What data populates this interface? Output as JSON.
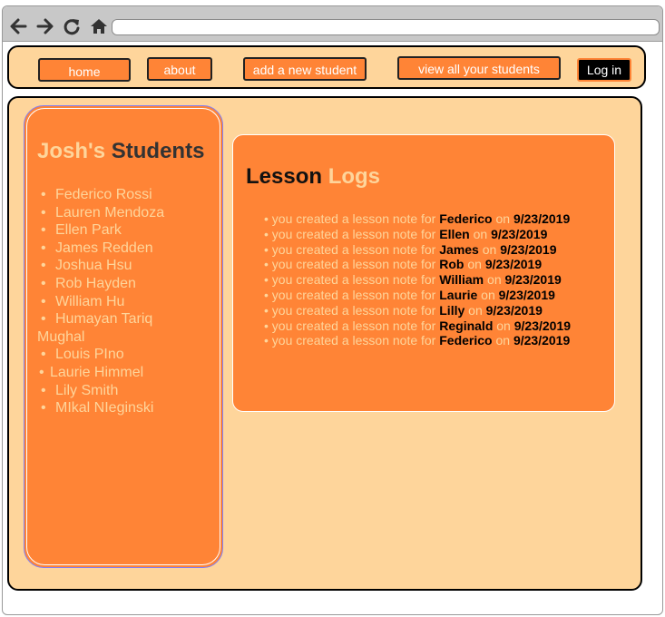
{
  "nav": {
    "home": "home",
    "about": "about",
    "add_student": "add a new student",
    "view_students": "view all your students",
    "login": "Log in"
  },
  "sidebar": {
    "title_owner": "Josh's",
    "title_word": "Students",
    "students": [
      {
        "bullet": "•",
        "name": "Federico Rossi"
      },
      {
        "bullet": "•",
        "name": "Lauren Mendoza"
      },
      {
        "bullet": "•",
        "name": "Ellen Park"
      },
      {
        "bullet": "•",
        "name": "James Redden"
      },
      {
        "bullet": "•",
        "name": "Joshua Hsu"
      },
      {
        "bullet": "•",
        "name": "Rob Hayden"
      },
      {
        "bullet": "•",
        "name": "William Hu"
      },
      {
        "bullet": "•",
        "name": "Humayan Tariq"
      },
      {
        "bullet": "",
        "name": "Mughal"
      },
      {
        "bullet": "•",
        "name": "Louis PIno"
      },
      {
        "bullet": "•",
        "name": "Laurie Himmel"
      },
      {
        "bullet": "•",
        "name": "Lily Smith"
      },
      {
        "bullet": "•",
        "name": "MIkal NIeginski"
      }
    ]
  },
  "logs": {
    "title_a": "Lesson",
    "title_b": "Logs",
    "entries": [
      {
        "prefix": "• you created a lesson note for",
        "name": "Federico",
        "on": "on",
        "date": "9/23/2019"
      },
      {
        "prefix": "• you created a lesson note for",
        "name": "Ellen",
        "on": "on",
        "date": "9/23/2019"
      },
      {
        "prefix": "• you created a lesson note for",
        "name": "James",
        "on": "on",
        "date": "9/23/2019"
      },
      {
        "prefix": "• you created a lesson note for",
        "name": "Rob",
        "on": "on",
        "date": "9/23/2019"
      },
      {
        "prefix": "• you created a lesson note for",
        "name": "William",
        "on": "on",
        "date": "9/23/2019"
      },
      {
        "prefix": "• you created a lesson note for",
        "name": "Laurie",
        "on": "on",
        "date": "9/23/2019"
      },
      {
        "prefix": "• you created a lesson note for",
        "name": "Lilly",
        "on": "on",
        "date": "9/23/2019"
      },
      {
        "prefix": "• you created a lesson note for",
        "name": "Reginald",
        "on": "on",
        "date": "9/23/2019"
      },
      {
        "prefix": "• you created a lesson note for",
        "name": "Federico",
        "on": "on",
        "date": "9/23/2019"
      }
    ]
  },
  "colors": {
    "accent": "#ff8436",
    "panel": "#fed59b",
    "text_light": "#fed59b"
  },
  "icons": [
    "back-arrow-icon",
    "forward-arrow-icon",
    "reload-icon",
    "home-icon"
  ]
}
